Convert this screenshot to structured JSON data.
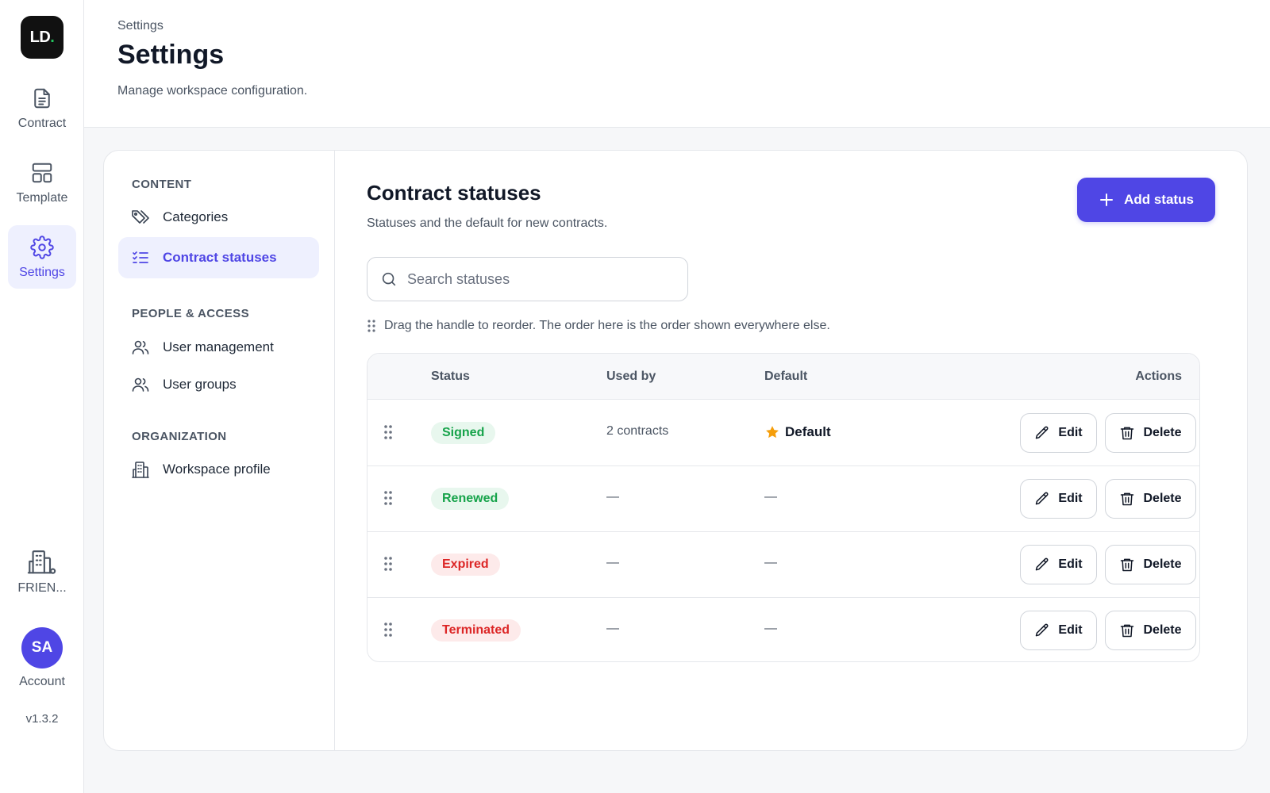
{
  "rail": {
    "logo": "LD",
    "logo_dot": ".",
    "items": [
      {
        "label": "Contract",
        "icon": "document-icon"
      },
      {
        "label": "Template",
        "icon": "layout-icon"
      },
      {
        "label": "Settings",
        "icon": "gear-icon"
      }
    ],
    "workspace_label": "FRIEN...",
    "avatar_initials": "SA",
    "account_label": "Account",
    "version": "v1.3.2"
  },
  "header": {
    "breadcrumb": "Settings",
    "title": "Settings",
    "subtitle": "Manage workspace configuration."
  },
  "subnav": {
    "sections": [
      {
        "label": "CONTENT",
        "items": [
          {
            "label": "Categories",
            "icon": "tag-icon"
          },
          {
            "label": "Contract statuses",
            "icon": "checklist-icon",
            "active": true
          }
        ]
      },
      {
        "label": "PEOPLE & ACCESS",
        "items": [
          {
            "label": "User management",
            "icon": "users-icon"
          },
          {
            "label": "User groups",
            "icon": "users-icon"
          }
        ]
      },
      {
        "label": "ORGANIZATION",
        "items": [
          {
            "label": "Workspace profile",
            "icon": "building-icon"
          }
        ]
      }
    ]
  },
  "main": {
    "title": "Contract statuses",
    "subtitle": "Statuses and the default for new contracts.",
    "add_button": "Add status",
    "search_placeholder": "Search statuses",
    "hint": "Drag the handle to reorder. The order here is the order shown everywhere else.",
    "columns": [
      "Status",
      "Used by",
      "Default",
      "Actions"
    ],
    "rows": [
      {
        "status": "Signed",
        "used_by": "2 contracts",
        "default": "Default"
      },
      {
        "status": "Renewed",
        "used_by": "—",
        "default": "—"
      },
      {
        "status": "Expired",
        "used_by": "—",
        "default": "—"
      },
      {
        "status": "Terminated",
        "used_by": "—",
        "default": "—"
      }
    ],
    "edit_label": "Edit",
    "delete_label": "Delete"
  },
  "colors": {
    "accent": "#4f46e5",
    "success": "#16a34a",
    "danger": "#dc2626",
    "star": "#f59e0b"
  }
}
